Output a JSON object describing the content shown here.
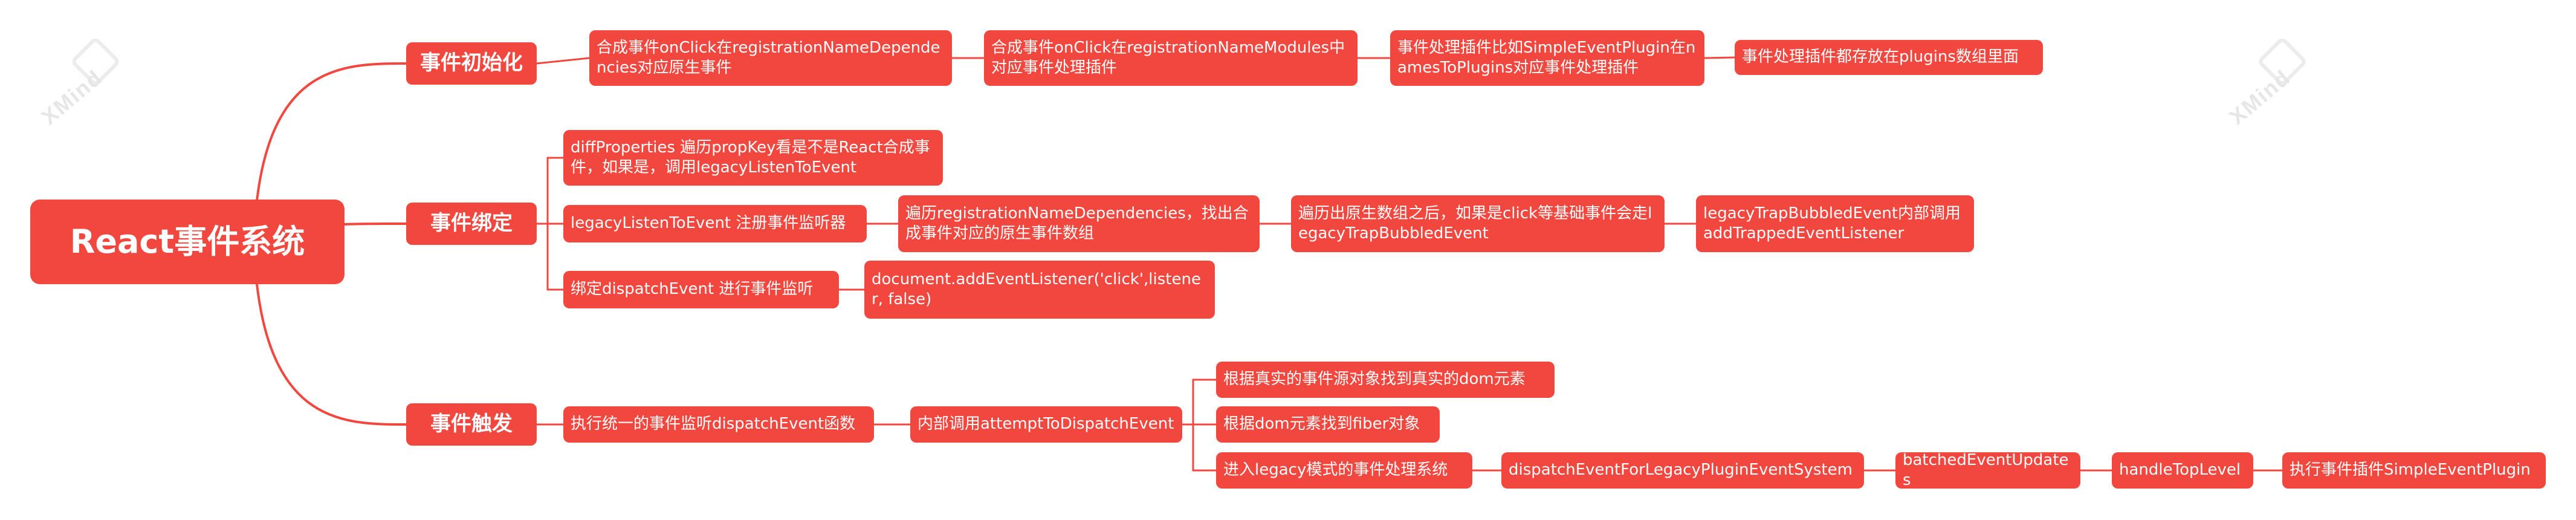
{
  "colors": {
    "node": "#f2473e",
    "line": "#f2473e",
    "text": "#ffffff",
    "watermark": "#e6e6e6"
  },
  "watermark": {
    "text": "XMind"
  },
  "root": {
    "label": "React事件系统"
  },
  "branches": [
    {
      "label": "事件初始化",
      "chain": [
        "合成事件onClick在registrationNameDependencies对应原生事件",
        "合成事件onClick在registrationNameModules中对应事件处理插件",
        "事件处理插件比如SimpleEventPlugin在namesToPlugins对应事件处理插件",
        "事件处理插件都存放在plugins数组里面"
      ]
    },
    {
      "label": "事件绑定",
      "items": [
        {
          "label": "diffProperties 遍历propKey看是不是React合成事件，如果是，调用legacyListenToEvent"
        },
        {
          "label": "legacyListenToEvent 注册事件监听器",
          "chain": [
            "遍历registrationNameDependencies，找出合成事件对应的原生事件数组",
            "遍历出原生数组之后，如果是click等基础事件会走legacyTrapBubbledEvent",
            "legacyTrapBubbledEvent内部调用addTrappedEventListener"
          ]
        },
        {
          "label": "绑定dispatchEvent 进行事件监听",
          "chain": [
            "document.addEventListener('click',listener, false)"
          ]
        }
      ]
    },
    {
      "label": "事件触发",
      "chain": [
        "执行统一的事件监听dispatchEvent函数",
        "内部调用attemptToDispatchEvent"
      ],
      "items": [
        {
          "label": "根据真实的事件源对象找到真实的dom元素"
        },
        {
          "label": "根据dom元素找到fiber对象"
        },
        {
          "label": "进入legacy模式的事件处理系统",
          "chain": [
            "dispatchEventForLegacyPluginEventSystem",
            "batchedEventUpdates",
            "handleTopLevel",
            "执行事件插件SimpleEventPlugin"
          ]
        }
      ]
    }
  ]
}
